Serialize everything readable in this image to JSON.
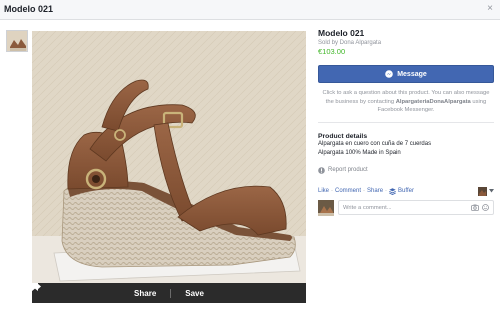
{
  "window": {
    "title": "Modelo 021",
    "close_glyph": "×"
  },
  "product": {
    "name": "Modelo 021",
    "seller": "Sold by Dona Alpargata",
    "price": "€103.00"
  },
  "message": {
    "button_label": "Message",
    "help_prefix": "Click to ask a question about this product. You can also message the business by contacting ",
    "help_business": "AlpargateriaDonaAlpargata",
    "help_suffix": " using Facebook Messenger."
  },
  "details": {
    "heading": "Product details",
    "lines": [
      "Alpargata en cuero con cuña de 7 cuerdas",
      "Alpargata 100% Made in Spain"
    ]
  },
  "report_label": "Report product",
  "social": {
    "like": "Like",
    "comment": "Comment",
    "share": "Share",
    "buffer": "Buffer",
    "sep": "·"
  },
  "comment_box": {
    "placeholder": "Write a comment..."
  },
  "viewer": {
    "share_label": "Share",
    "save_label": "Save"
  },
  "colors": {
    "accent": "#4267b2",
    "price": "#42b72a",
    "leather": "#8b5a3c",
    "jute": "#d9cfbf"
  },
  "icons": [
    "close-icon",
    "messenger-icon",
    "report-icon",
    "buffer-icon",
    "share-icon",
    "save-icon",
    "camera-icon",
    "emoji-icon",
    "chevron-down-icon"
  ]
}
